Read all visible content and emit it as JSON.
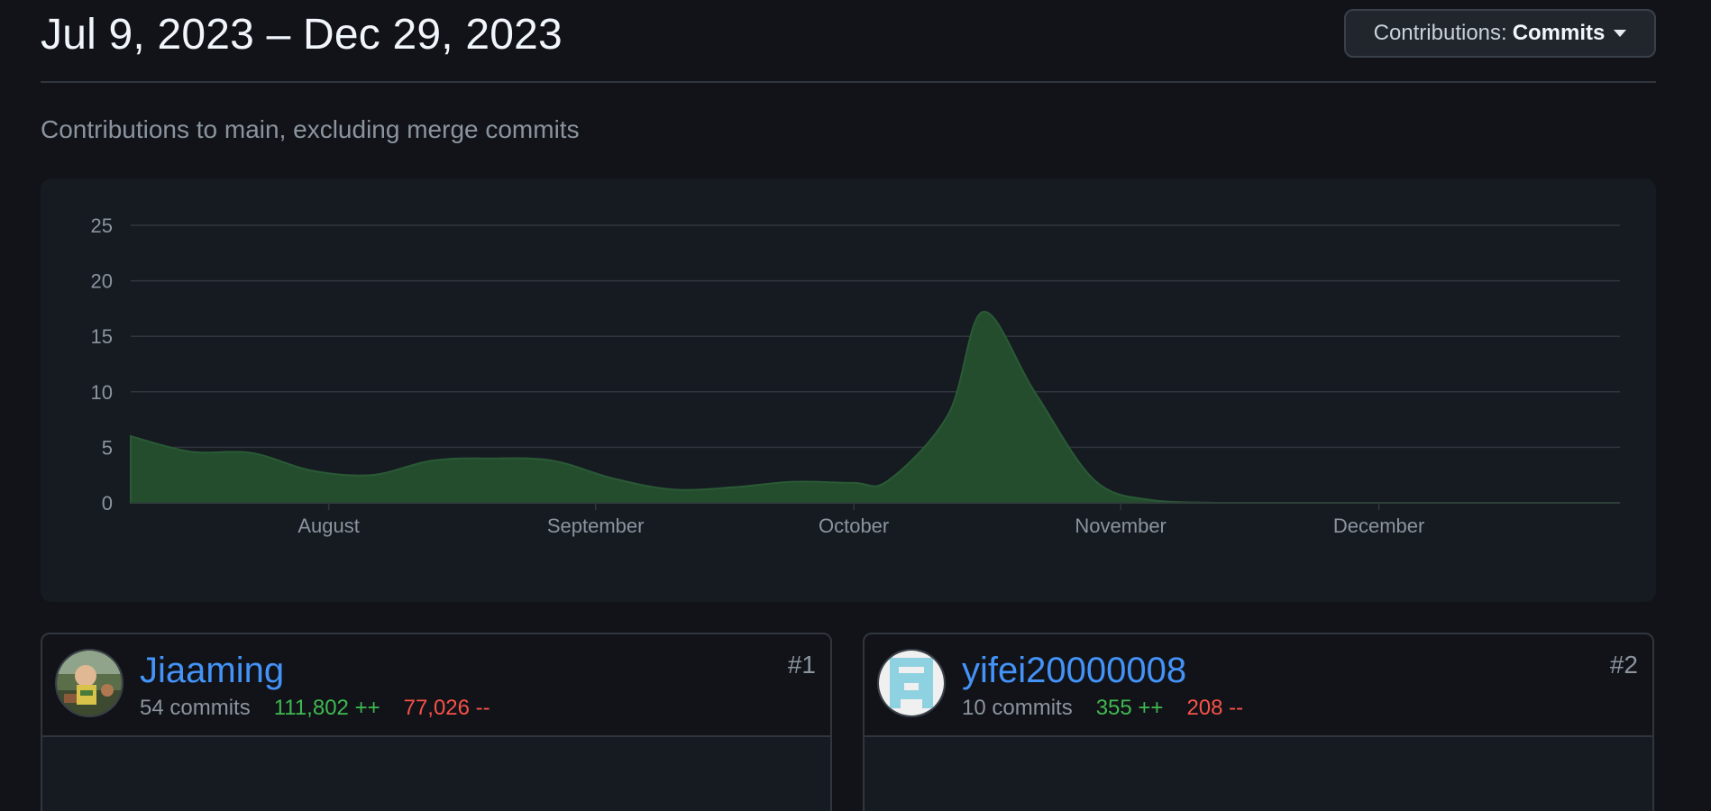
{
  "header": {
    "date_range": "Jul 9, 2023 – Dec 29, 2023",
    "select_prefix": "Contributions:",
    "select_value": "Commits"
  },
  "subtitle": "Contributions to main, excluding merge commits",
  "chart_data": {
    "type": "area",
    "series": [
      {
        "values": [
          6.0,
          4.6,
          4.5,
          2.9,
          2.5,
          3.8,
          4.0,
          3.8,
          2.2,
          1.2,
          1.4,
          1.9,
          1.8,
          2.0,
          8.0,
          17.2,
          10.0,
          2.0,
          0.2,
          0,
          0,
          0,
          0,
          0,
          0,
          0
        ]
      }
    ],
    "x": [
      "2023-07-09",
      "2023-07-16",
      "2023-07-23",
      "2023-07-30",
      "2023-08-06",
      "2023-08-13",
      "2023-08-20",
      "2023-08-27",
      "2023-09-03",
      "2023-09-10",
      "2023-09-17",
      "2023-09-24",
      "2023-10-01",
      "2023-10-05",
      "2023-10-12",
      "2023-10-16",
      "2023-10-22",
      "2023-10-29",
      "2023-11-05",
      "2023-11-12",
      "2023-11-19",
      "2023-11-26",
      "2023-12-03",
      "2023-12-10",
      "2023-12-17",
      "2023-12-29"
    ],
    "xlim": [
      "2023-07-09",
      "2023-12-29"
    ],
    "ylim": [
      0,
      25
    ],
    "yticks": [
      0,
      5,
      10,
      15,
      20,
      25
    ],
    "xticks": [
      {
        "label": "August",
        "date": "2023-08-01"
      },
      {
        "label": "September",
        "date": "2023-09-01"
      },
      {
        "label": "October",
        "date": "2023-10-01"
      },
      {
        "label": "November",
        "date": "2023-11-01"
      },
      {
        "label": "December",
        "date": "2023-12-01"
      }
    ],
    "grid": true,
    "colors": {
      "fill": "#244d2e",
      "stroke": "#2a5a35",
      "grid": "#30363d",
      "tick_text": "#8b949e"
    }
  },
  "contributors": [
    {
      "rank": "#1",
      "username": "Jiaaming",
      "commits": "54 commits",
      "additions": "111,802 ++",
      "deletions": "77,026 --",
      "avatar": "photo-avatar"
    },
    {
      "rank": "#2",
      "username": "yifei20000008",
      "commits": "10 commits",
      "additions": "355 ++",
      "deletions": "208 --",
      "avatar": "identicon-avatar"
    }
  ],
  "colors": {
    "background": "#111318",
    "card": "#161b22",
    "link": "#4493f8",
    "additions": "#3fb950",
    "deletions": "#f85149"
  }
}
